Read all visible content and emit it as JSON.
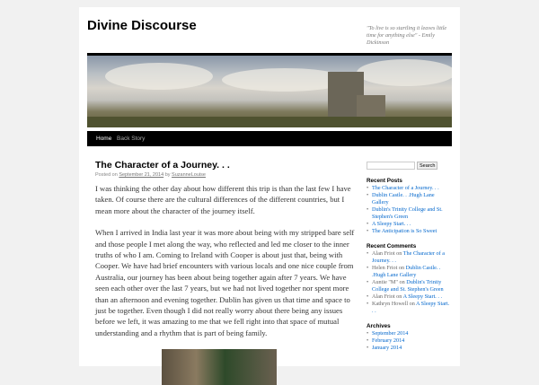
{
  "site": {
    "title": "Divine Discourse",
    "tagline": "\"To live is so startling it leaves little time for anything else\" - Emily Dickinson"
  },
  "nav": {
    "items": [
      "Home",
      "Back Story"
    ]
  },
  "post": {
    "title": "The Character of a Journey. . .",
    "posted_on": "Posted on",
    "date": "September 21, 2014",
    "by": "by",
    "author": "SuzanneLouise",
    "paragraphs": [
      "I was thinking the other day about how different this trip is than the last few I have taken. Of course there are the cultural differences of the different countries, but I mean more about the character of the journey itself.",
      "When I arrived in India last year it was more about being with my stripped bare self and those people I met along the way, who reflected and led me closer to the inner truths of who I am. Coming to Ireland with Cooper is about just that, being with Cooper. We have had brief encounters with various locals and one nice couple from Australia, our journey has been about being together again after 7 years. We have seen each other over the last 7 years, but we had not lived together nor spent more than an afternoon and evening together. Dublin has given us that time and space to just be together. Even though I did not really worry about there being any issues before we left, it was amazing to me that we fell right into that space of mutual understanding and a rhythm that is part of being family."
    ]
  },
  "sidebar": {
    "search_button": "Search",
    "recent_posts_title": "Recent Posts",
    "recent_posts": [
      "The Character of a Journey. . .",
      "Dublin Castle. . .Hugh Lane Gallery",
      "Dublin's Trinity College and St. Stephen's Green",
      "A Sleepy Start. . .",
      "The Anticipation is So Sweet"
    ],
    "recent_comments_title": "Recent Comments",
    "on": "on",
    "recent_comments": [
      {
        "author": "Alan Friot",
        "post": "The Character of a Journey. . ."
      },
      {
        "author": "Helen Friot",
        "post": "Dublin Castle. . .Hugh Lane Gallery"
      },
      {
        "author": "Auntie \"M\"",
        "post": "Dublin's Trinity College and St. Stephen's Green"
      },
      {
        "author": "Alan Friot",
        "post": "A Sleepy Start. . ."
      },
      {
        "author": "Kathryn Howell",
        "post": "A Sleepy Start. . ."
      }
    ],
    "archives_title": "Archives",
    "archives": [
      "September 2014",
      "February 2014",
      "January 2014"
    ]
  }
}
